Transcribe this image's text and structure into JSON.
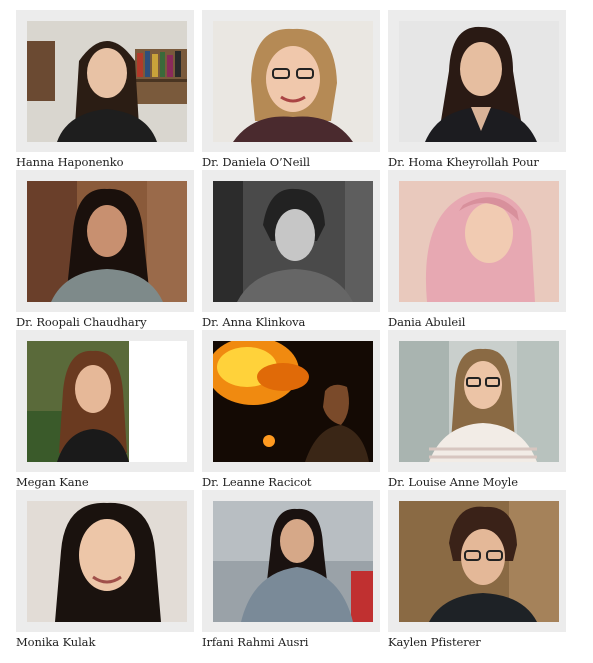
{
  "people": [
    {
      "name": "Hanna Haponenko"
    },
    {
      "name": "Dr. Daniela O’Neill"
    },
    {
      "name": "Dr. Homa Kheyrollah Pour"
    },
    {
      "name": "Dr. Roopali Chaudhary"
    },
    {
      "name": "Dr. Anna Klinkova"
    },
    {
      "name": "Dania Abuleil"
    },
    {
      "name": "Megan Kane"
    },
    {
      "name": "Dr. Leanne Racicot"
    },
    {
      "name": "Dr. Louise Anne Moyle"
    },
    {
      "name": "Monika Kulak"
    },
    {
      "name": "Irfani Rahmi Ausri"
    },
    {
      "name": "Kaylen Pfisterer"
    }
  ]
}
